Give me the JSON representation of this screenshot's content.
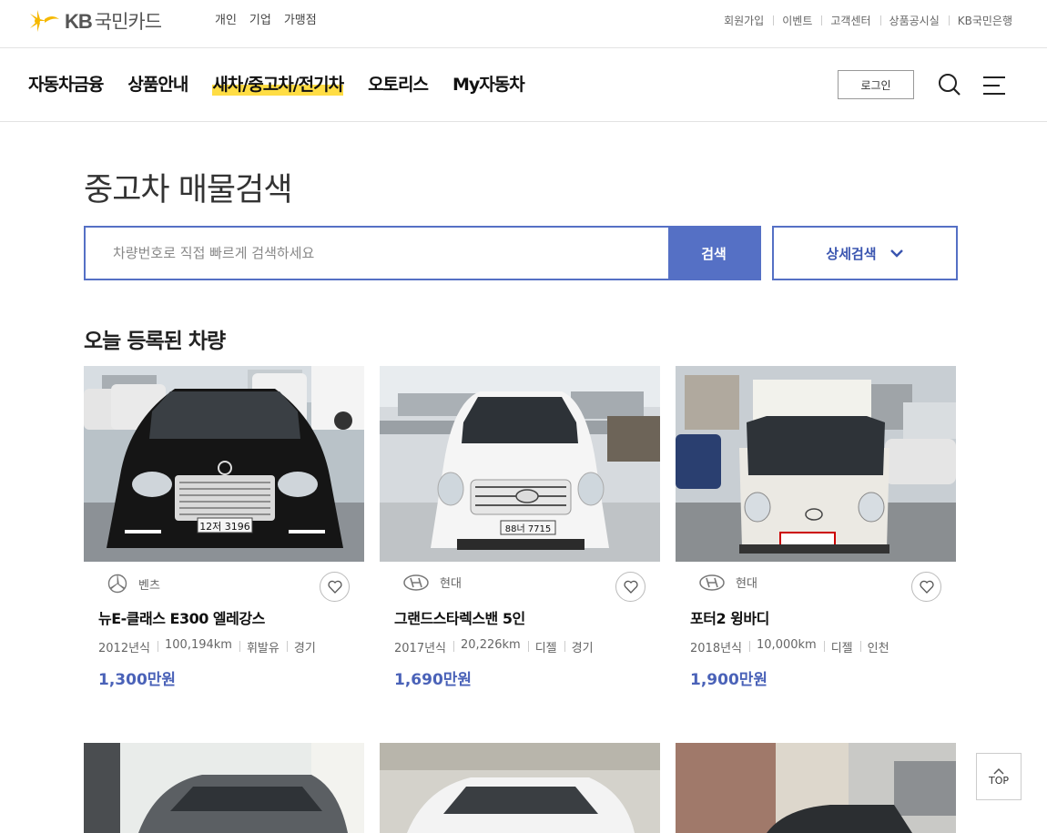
{
  "header": {
    "logo_latin": "KB",
    "logo_korean": "국민카드",
    "segments": [
      "개인",
      "기업",
      "가맹점"
    ],
    "util_links": [
      "회원가입",
      "이벤트",
      "고객센터",
      "상품공시실",
      "KB국민은행"
    ]
  },
  "nav": {
    "items": [
      "자동차금융",
      "상품안내",
      "새차/중고차/전기차",
      "오토리스",
      "My자동차"
    ],
    "active_index": 2,
    "login_label": "로그인",
    "icons": [
      "search-icon",
      "menu-icon"
    ]
  },
  "main": {
    "title": "중고차 매물검색",
    "search": {
      "placeholder": "차량번호로 직접 빠르게 검색하세요",
      "button_label": "검색"
    },
    "detail_search_label": "상세검색",
    "section_title": "오늘 등록된 차량"
  },
  "cars": [
    {
      "brand": "벤츠",
      "brand_icon": "mercedes-logo-icon",
      "name": "뉴E-클래스 E300 엘레강스",
      "specs": [
        "2012년식",
        "100,194km",
        "휘발유",
        "경기"
      ],
      "price": "1,300만원",
      "plate": "12저 3196",
      "body_color": "#1a1a1a"
    },
    {
      "brand": "현대",
      "brand_icon": "hyundai-logo-icon",
      "name": "그랜드스타렉스밴 5인",
      "specs": [
        "2017년식",
        "20,226km",
        "디젤",
        "경기"
      ],
      "price": "1,690만원",
      "plate": "88너 7715",
      "body_color": "#f2f2f2"
    },
    {
      "brand": "현대",
      "brand_icon": "hyundai-logo-icon",
      "name": "포터2 윙바디",
      "specs": [
        "2018년식",
        "10,000km",
        "디젤",
        "인천"
      ],
      "price": "1,900만원",
      "plate": "",
      "body_color": "#e8e6e0"
    }
  ],
  "top_button_label": "TOP",
  "colors": {
    "accent": "#5570c5",
    "price": "#4a62b8",
    "highlight": "#ffdd44"
  }
}
